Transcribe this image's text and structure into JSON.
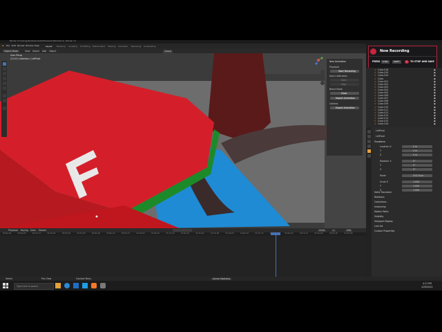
{
  "app": {
    "title": "Blender [C:\\Users\\gabre\\Downloads\\adhesive\\untitled.blend] - Blender 4.1",
    "menus": [
      "File",
      "Edit",
      "Render",
      "Window",
      "Help"
    ],
    "workspace_tabs": [
      "Layout",
      "Modeling",
      "Sculpting",
      "UV Editing",
      "Texture Paint",
      "Shading",
      "Animation",
      "Rendering",
      "Compositing",
      "Geometry Nodes",
      "Scripting"
    ],
    "active_workspace": "Layout"
  },
  "viewport": {
    "mode": "Object Mode",
    "menus": [
      "View",
      "Select",
      "Add",
      "Object"
    ],
    "overlay_label": "User Persp",
    "collection_label": "(2110) Collection | LeftFoot",
    "orientation": "Global"
  },
  "npanel": {
    "title": "New Animation",
    "items": [
      "Playback",
      "Blend Mode",
      "Import",
      "Export"
    ],
    "buttons": [
      "Start Recording",
      "Start",
      "Stop",
      "Clear",
      "Import Animation",
      "Export Animation"
    ],
    "section_a": "Auto Calibration",
    "section_b": "Options"
  },
  "recording": {
    "title": "Now Recording",
    "press": "PRESS",
    "key1": "CTRL",
    "key2": "SHIFT",
    "key3": "1",
    "suffix": "TO STOP AND SAVE",
    "accent": "#c8253e"
  },
  "outliner": {
    "rows": [
      "Cube.018",
      "Cube.019",
      "Cube.020",
      "Cube",
      "Cube.001",
      "Cube.002",
      "Cube.003",
      "Cube.004",
      "Cube.005",
      "Cube.006",
      "Cube.007",
      "Cube.008",
      "Cube.009",
      "Cube.010",
      "Cube.011",
      "Cube.012",
      "Cube.013",
      "Cube.014",
      "Cube.015",
      "Cube.016"
    ]
  },
  "properties": {
    "object_name": "LeftFoot",
    "sub_name": "LeftFoot",
    "section": "Transform",
    "fields": [
      {
        "label": "Location X",
        "value": "0 m"
      },
      {
        "label": "Y",
        "value": "0 m"
      },
      {
        "label": "Z",
        "value": "0 m"
      },
      {
        "label": "Rotation X",
        "value": "0°"
      },
      {
        "label": "Y",
        "value": "0°"
      },
      {
        "label": "Z",
        "value": "0°"
      },
      {
        "label": "Mode",
        "value": "XYZ Euler"
      },
      {
        "label": "Scale X",
        "value": "1.000"
      },
      {
        "label": "Y",
        "value": "1.000"
      },
      {
        "label": "Z",
        "value": "1.000"
      }
    ],
    "panels": [
      "Delta Transform",
      "Relations",
      "Collections",
      "Instancing",
      "Motion Paths",
      "Visibility",
      "Viewport Display",
      "Line Art",
      "Custom Properties"
    ]
  },
  "timeline": {
    "menus": [
      "Playback",
      "Keying",
      "View",
      "Marker"
    ],
    "current_frame": "2110",
    "start": "1",
    "end": "250",
    "ticks": [
      "00:00+00",
      "00:06+06",
      "00:13+13",
      "00:20+05",
      "00:25+00",
      "00:33+08",
      "00:40+00",
      "00:46+16",
      "00:53+13",
      "01:00+00",
      "01:06+16",
      "01:13+13",
      "01:20+05",
      "01:25+00",
      "01:33+08",
      "01:40+00",
      "01:46+16",
      "01:53+13",
      "02:00+00",
      "02:06+16",
      "02:13+13",
      "02:20+05",
      "02:25+00",
      "02:33+08"
    ]
  },
  "status": {
    "left": [
      "Select",
      "Pan View",
      "Context Menu"
    ],
    "right": "Scene Statistics"
  },
  "taskbar": {
    "search_placeholder": "Type here to search",
    "time": "4:11 PM",
    "date": "1/29/2024"
  }
}
